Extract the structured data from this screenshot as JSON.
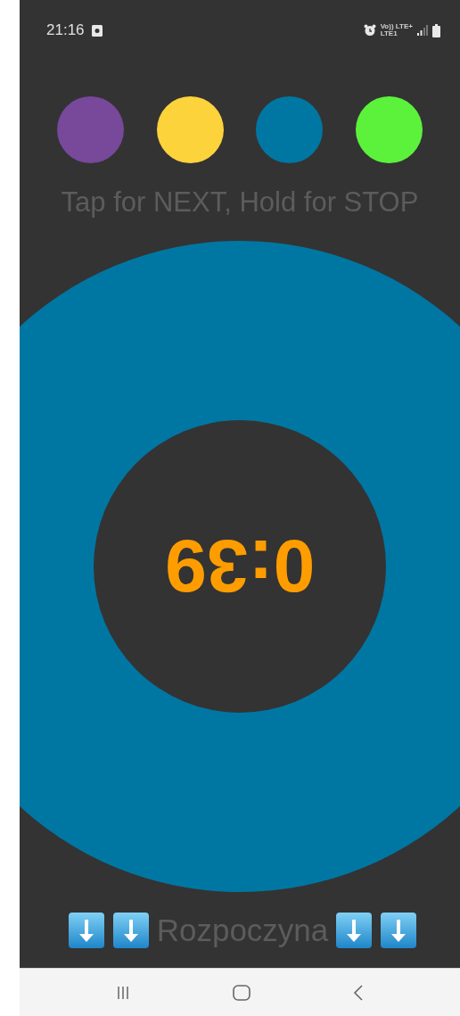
{
  "status_bar": {
    "time": "21:16",
    "network_top": "Vo)) LTE+",
    "network_bottom": "LTE1"
  },
  "colors": [
    {
      "color": "#78489a"
    },
    {
      "color": "#fdd33c"
    },
    {
      "color": "#0077a3"
    },
    {
      "color": "#5cf23c"
    }
  ],
  "hint": "Tap for NEXT, Hold for STOP",
  "timer": {
    "value": "0:39",
    "color": "#0077a3"
  },
  "footer": {
    "label": "Rozpoczyna"
  }
}
